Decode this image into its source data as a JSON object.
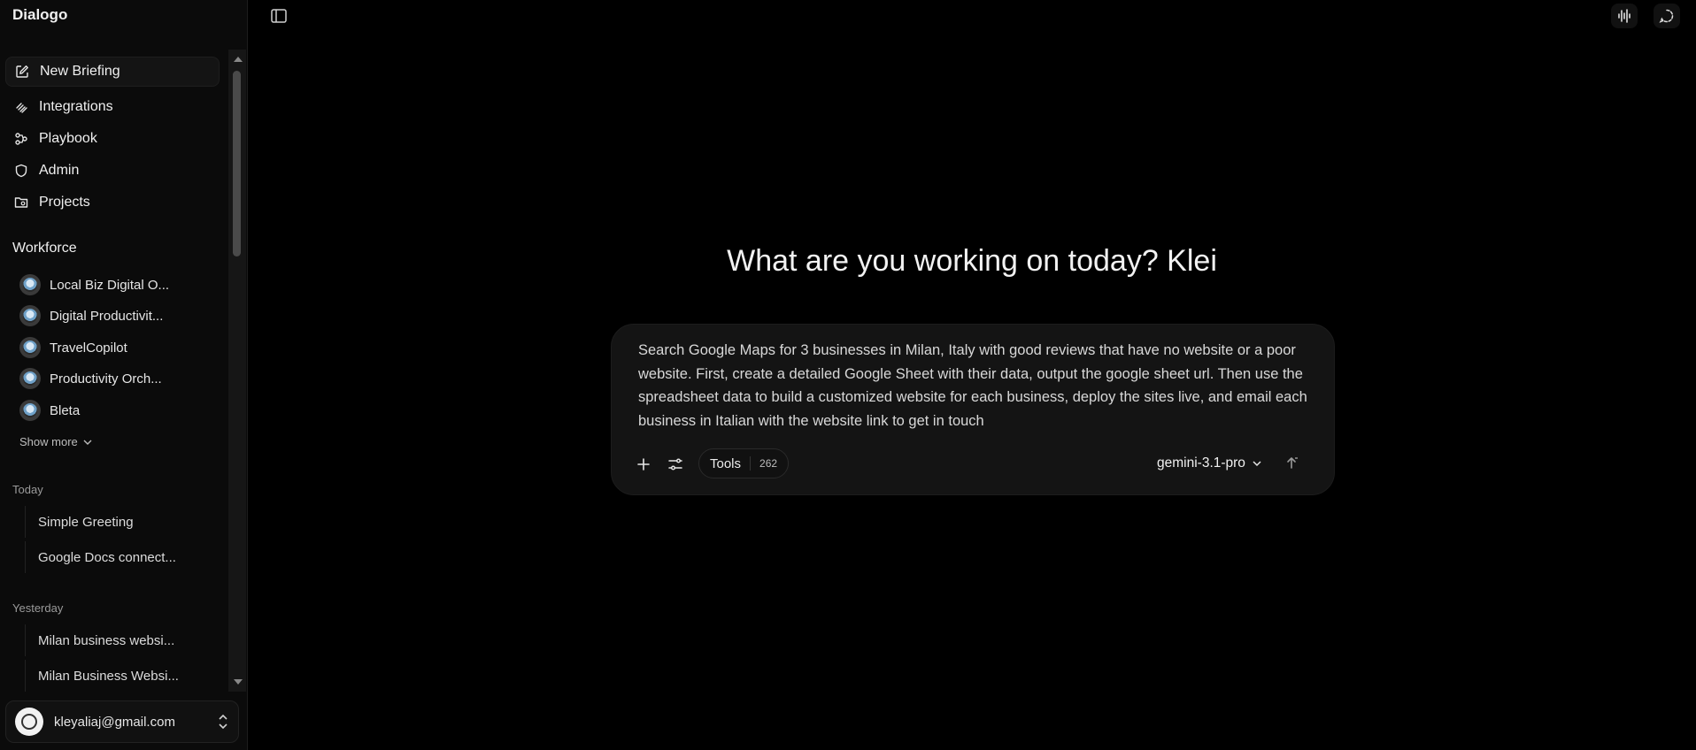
{
  "app": {
    "name": "Dialogo"
  },
  "nav": [
    {
      "label": "New Briefing",
      "icon": "edit-icon",
      "active": true
    },
    {
      "label": "Integrations",
      "icon": "integrations-icon",
      "active": false
    },
    {
      "label": "Playbook",
      "icon": "playbook-icon",
      "active": false
    },
    {
      "label": "Admin",
      "icon": "shield-icon",
      "active": false
    },
    {
      "label": "Projects",
      "icon": "projects-icon",
      "active": false
    }
  ],
  "workforce": {
    "title": "Workforce",
    "agents": [
      {
        "name": "Local Biz Digital O..."
      },
      {
        "name": "Digital Productivit..."
      },
      {
        "name": "TravelCopilot"
      },
      {
        "name": "Productivity Orch..."
      },
      {
        "name": "Bleta"
      }
    ],
    "show_more": "Show more"
  },
  "history": {
    "today_label": "Today",
    "today": [
      {
        "title": "Simple Greeting"
      },
      {
        "title": "Google Docs connect..."
      }
    ],
    "yesterday_label": "Yesterday",
    "yesterday": [
      {
        "title": "Milan business websi..."
      },
      {
        "title": "Milan Business Websi..."
      }
    ]
  },
  "user": {
    "email": "kleyaliaj@gmail.com"
  },
  "main": {
    "greeting": "What are you working on today? Klei",
    "prompt_text": "Search Google Maps for 3 businesses in Milan, Italy with good reviews that have no website or a poor website. First, create a detailed Google Sheet with their data, output the google sheet url. Then use the spreadsheet data to build a customized website for each business, deploy the sites live, and email each business in Italian with the website link to get in touch",
    "tools_label": "Tools",
    "tools_count": "262",
    "model": "gemini-3.1-pro"
  }
}
